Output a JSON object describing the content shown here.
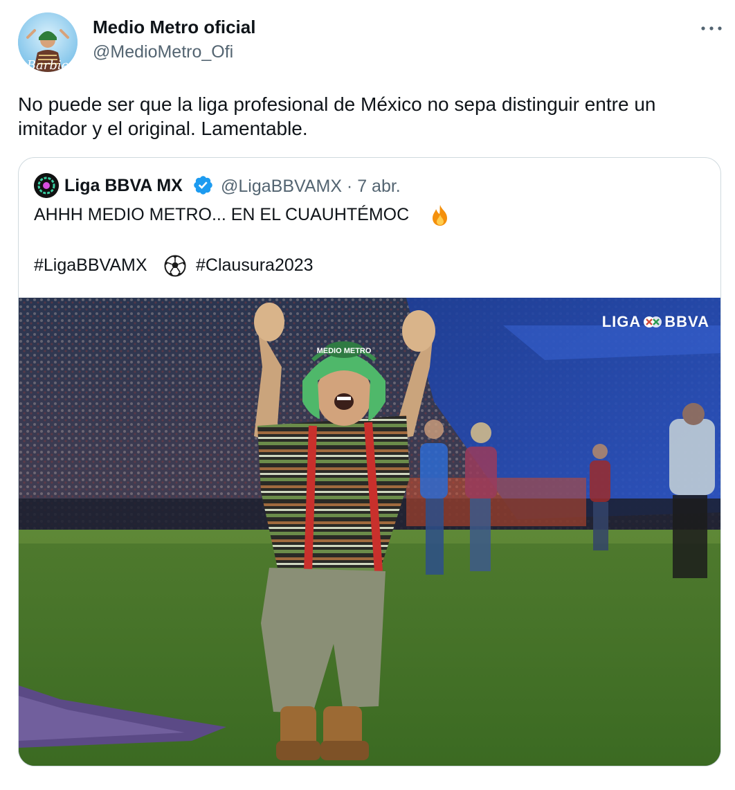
{
  "tweet": {
    "author_name": "Medio Metro oficial",
    "author_handle": "@MedioMetro_Ofi",
    "avatar_caption": "Barbie",
    "text": "No puede ser que la liga profesional de México no sepa distinguir entre un imitador y el original. Lamentable."
  },
  "quote": {
    "author_name": "Liga BBVA MX",
    "meta": "@LigaBBVAMX · 7 abr.",
    "line1": "AHHH MEDIO METRO... EN EL CUAUHTÉMOC",
    "hashtag1": "#LigaBBVAMX",
    "hashtag2": "#Clausura2023",
    "media": {
      "watermark_left": "LIGA",
      "watermark_right": "BBVA",
      "hat_text": "MEDIO METRO"
    }
  },
  "icons": {
    "more": "more-icon",
    "verified": "verified-icon",
    "fire": "fire-icon",
    "ball": "soccer-ball-icon"
  },
  "colors": {
    "text": "#0f1419",
    "secondary": "#536471",
    "verified": "#1d9bf0",
    "border": "#cfd9de"
  }
}
